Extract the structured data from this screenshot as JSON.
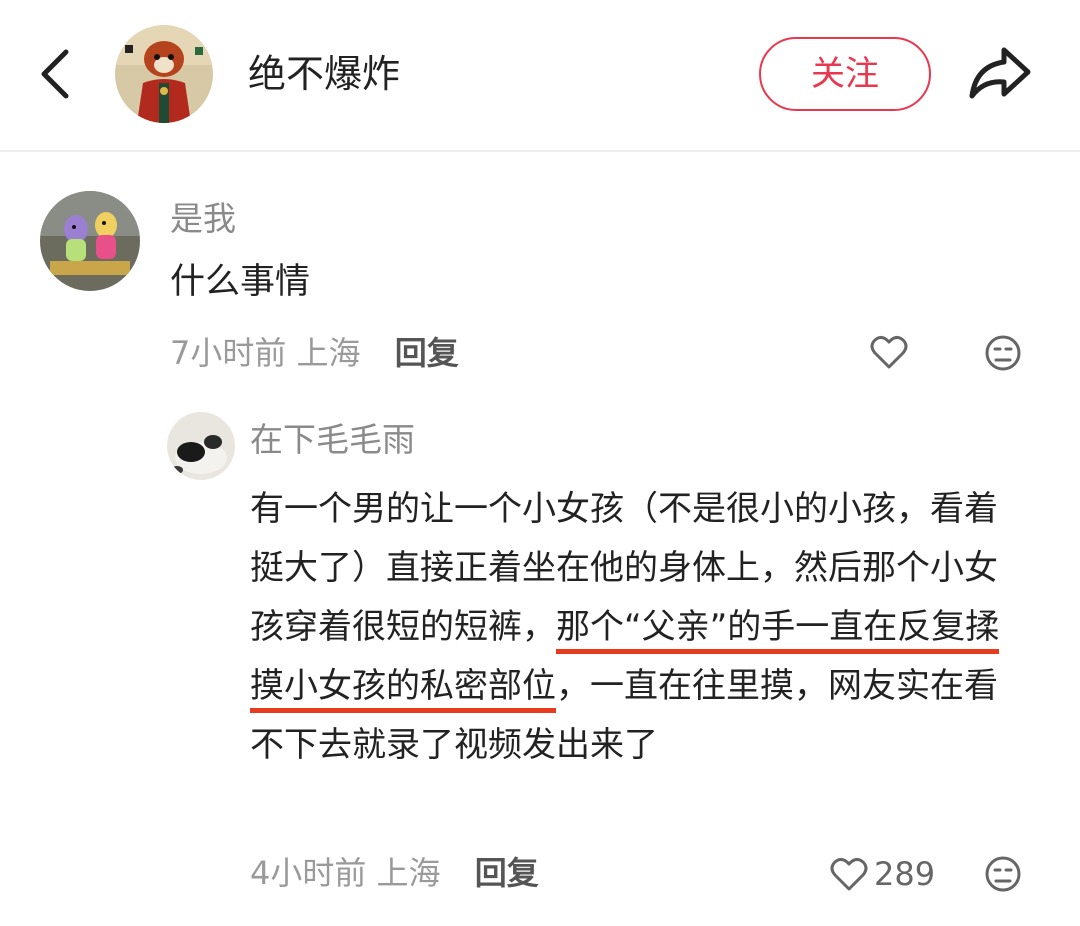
{
  "header": {
    "title": "绝不爆炸",
    "follow_label": "关注"
  },
  "comments": [
    {
      "username": "是我",
      "text": "什么事情",
      "time": "7小时前",
      "location": "上海",
      "reply_label": "回复"
    },
    {
      "username": "在下毛毛雨",
      "text_parts": {
        "p1": "有一个男的让一个小女孩（不是很小的小孩，看着挺大了）直接正着坐在他的身体上，然后那个小女孩穿着很短的短裤，",
        "p2": "那个“父亲”的手一直在反复揉摸小女孩的私密部位",
        "p3": "，一直在往里摸，网友实在看不下去就录了视频发出来了"
      },
      "time": "4小时前",
      "location": "上海",
      "reply_label": "回复",
      "like_count": "289"
    }
  ],
  "icons": {
    "back": "chevron-left-icon",
    "share": "share-arrow-icon",
    "like": "heart-outline-icon",
    "dislike": "sad-face-icon"
  },
  "colors": {
    "accent": "#e8384f",
    "underline": "#e63b1f",
    "muted": "#9a9a9a"
  }
}
